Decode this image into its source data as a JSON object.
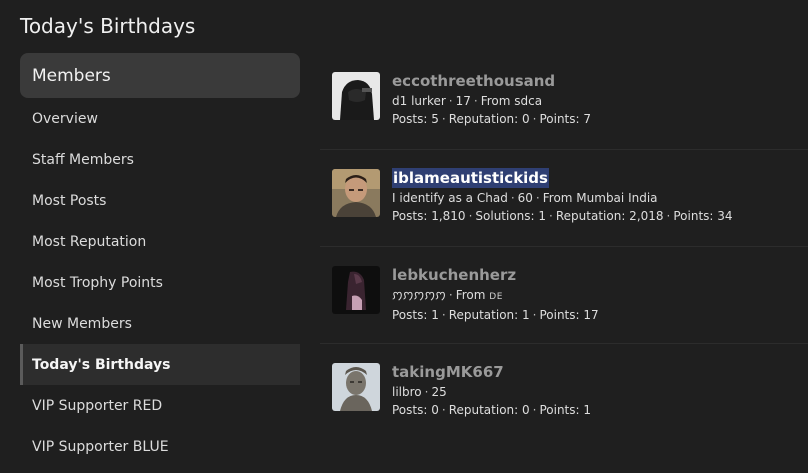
{
  "page": {
    "title": "Today's Birthdays"
  },
  "sidebar": {
    "header": "Members",
    "items": [
      {
        "label": "Overview"
      },
      {
        "label": "Staff Members"
      },
      {
        "label": "Most Posts"
      },
      {
        "label": "Most Reputation"
      },
      {
        "label": "Most Trophy Points"
      },
      {
        "label": "New Members"
      },
      {
        "label": "Today's Birthdays"
      },
      {
        "label": "VIP Supporter RED"
      },
      {
        "label": "VIP Supporter BLUE"
      }
    ],
    "active_label": "Today's Birthdays"
  },
  "members": [
    {
      "username": "eccothreethousand",
      "title": "d1 lurker",
      "age": "17",
      "from": "From sdca",
      "posts": "Posts: 5",
      "reputation": "Reputation: 0",
      "points": "Points: 7"
    },
    {
      "username": "iblameautistickids",
      "title": "I identify as a Chad",
      "age": "60",
      "from": "From Mumbai India",
      "posts": "Posts: 1,810",
      "solutions": "Solutions: 1",
      "reputation": "Reputation: 2,018",
      "points": "Points: 34"
    },
    {
      "username": "lebkuchenherz",
      "title": "ꩀꩀꩀꩀꩀ",
      "from_prefix": "From",
      "from_flag": "DE",
      "posts": "Posts: 1",
      "reputation": "Reputation: 1",
      "points": "Points: 17"
    },
    {
      "username": "takingMK667",
      "title": "lilbro",
      "age": "25",
      "posts": "Posts: 0",
      "reputation": "Reputation: 0",
      "points": "Points: 1"
    }
  ],
  "colors": {
    "background": "#1f1f1f",
    "sidebar_header_bg": "#3a3a3a",
    "active_item_bg": "#2d2d2d",
    "username_color": "#9a9a9a",
    "highlight_bg": "#2f3f73"
  }
}
